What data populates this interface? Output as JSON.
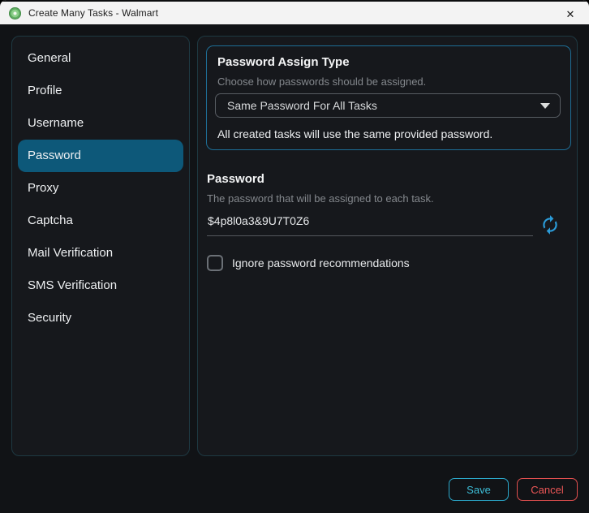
{
  "window": {
    "title": "Create Many Tasks - Walmart",
    "close_glyph": "✕"
  },
  "sidebar": {
    "selected": "Password",
    "items": [
      {
        "label": "General"
      },
      {
        "label": "Profile"
      },
      {
        "label": "Username"
      },
      {
        "label": "Password"
      },
      {
        "label": "Proxy"
      },
      {
        "label": "Captcha"
      },
      {
        "label": "Mail Verification"
      },
      {
        "label": "SMS Verification"
      },
      {
        "label": "Security"
      }
    ]
  },
  "main": {
    "assign_box": {
      "title": "Password Assign Type",
      "subtitle": "Choose how passwords should be assigned.",
      "dropdown_value": "Same Password For All Tasks",
      "note": "All created tasks will use the same provided password."
    },
    "password_section": {
      "title": "Password",
      "subtitle": "The password that will be assigned to each task.",
      "value": "$4p8l0a3&9U7T0Z6",
      "checkbox_label": "Ignore password recommendations",
      "checkbox_checked": false
    }
  },
  "footer": {
    "save_label": "Save",
    "cancel_label": "Cancel"
  },
  "colors": {
    "titlebar_bg": "#f3f3f3",
    "panel_bg": "#16181c",
    "panel_border": "#1e3942",
    "accent_box_border": "#1e6e96",
    "selected_item_bg": "#0d5879",
    "refresh_blue": "#2b9bd8",
    "save_accent": "#3dbdd6",
    "cancel_accent": "#e04f4f"
  }
}
